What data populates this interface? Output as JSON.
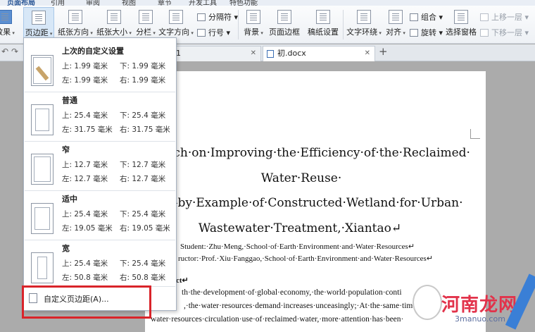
{
  "ribbon_tabs": [
    "页面布局",
    "引用",
    "审阅",
    "视图",
    "章节",
    "开发工具",
    "特色功能"
  ],
  "ribbon": {
    "margins": "页边距",
    "orientation": "纸张方向",
    "size": "纸张大小",
    "columns": "分栏",
    "text_direction": "文字方向",
    "line_numbers": "行号",
    "breaks": "分隔符",
    "background": "背景",
    "page_border": "页面边框",
    "manuscript": "稿纸设置",
    "wrap_text": "文字环绕",
    "align": "对齐",
    "group": "组合",
    "rotate": "旋转",
    "select_pane": "选择窗格",
    "bring_forward": "上移一层",
    "send_backward": "下移一层",
    "left_cut": "效果"
  },
  "doc_tabs": [
    {
      "label": "1"
    },
    {
      "label": "初.docx"
    }
  ],
  "menu": {
    "items": [
      {
        "name": "上次的自定义设置",
        "top": "上: 1.99 毫米",
        "bottom": "下: 1.99 毫米",
        "left": "左: 1.99 毫米",
        "right": "右: 1.99 毫米"
      },
      {
        "name": "普通",
        "top": "上: 25.4 毫米",
        "bottom": "下: 25.4 毫米",
        "left": "左: 31.75 毫米",
        "right": "右: 31.75 毫米"
      },
      {
        "name": "窄",
        "top": "上: 12.7 毫米",
        "bottom": "下: 12.7 毫米",
        "left": "左: 12.7 毫米",
        "right": "右: 12.7 毫米"
      },
      {
        "name": "适中",
        "top": "上: 25.4 毫米",
        "bottom": "下: 25.4 毫米",
        "left": "左: 19.05 毫米",
        "right": "右: 19.05 毫米"
      },
      {
        "name": "宽",
        "top": "上: 25.4 毫米",
        "bottom": "下: 25.4 毫米",
        "left": "左: 50.8 毫米",
        "right": "右: 50.8 毫米"
      }
    ],
    "custom": "自定义页边距(A)..."
  },
  "doc": {
    "title1": "earch·on·Improving·the·Efficiency·of·the·Reclaimed·",
    "title2": "Water·Reuse·",
    "title3": "——by·Example·of·Constructed·Wetland·for·Urban·",
    "title4": "Wastewater·Treatment,·Xiantao↵",
    "student": "Student:·Zhu·Meng,·School·of·Earth·Environment·and·Water·Resources↵",
    "instructor": "ructor:·Prof.·Xiu·Fanggao,·School·of·Earth·Environment·and·Water·Resources↵",
    "abstract": "ct↵",
    "line1": "th·the·development·of·global·economy,·the·world·population·conti",
    "line2": ",·the·water·resources·demand·increases·unceasingly;·At·the·same·tim",
    "line3": "water·resources·circulation·use·of·reclaimed·water,·more·attention·has·been·"
  },
  "watermark": {
    "text": "河南龙网",
    "sub": "3manuo.com"
  },
  "colors": {
    "highlight": "#d9242a",
    "accent": "#2b5797"
  }
}
